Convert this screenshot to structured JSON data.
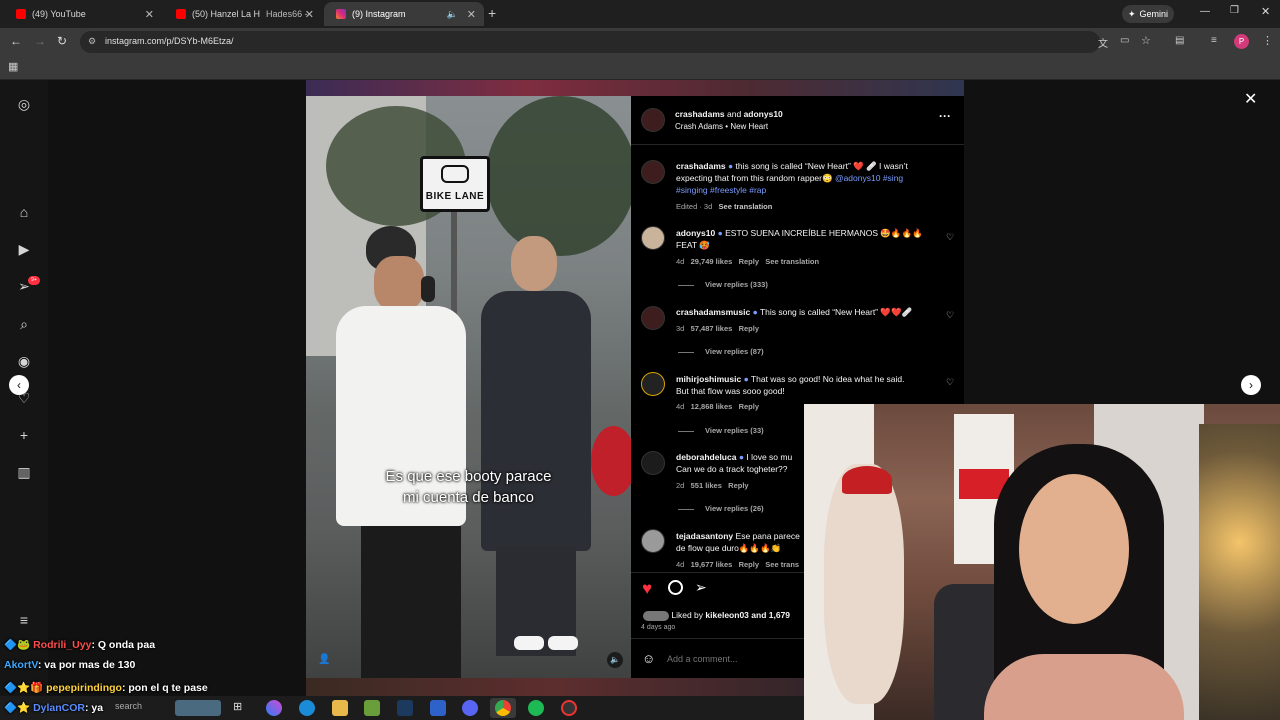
{
  "browser": {
    "tabs": [
      {
        "label": "(49) YouTube",
        "active": false
      },
      {
        "label": "(50) Hanzel La H",
        "label2": "Hades66 -",
        "active": false
      },
      {
        "label": "(9) Instagram",
        "active": true
      }
    ],
    "url": "instagram.com/p/DSYb-M6Etza/",
    "gemini_label": "Gemini",
    "profile_initial": "P"
  },
  "sidebar": {
    "icons": [
      "instagram-icon",
      "home-icon",
      "reels-icon",
      "messages-icon",
      "search-icon",
      "explore-icon",
      "notifications-icon",
      "create-icon",
      "dashboard-icon",
      "more-icon"
    ],
    "notification_badge": "9+"
  },
  "video": {
    "sign_text": "BIKE LANE",
    "subtitle_line1": "Es que ese booty parace",
    "subtitle_line2": "mi cuenta de banco"
  },
  "post": {
    "header": {
      "author": "crashadams",
      "and": "and",
      "collaborator": "adonys10",
      "audio_artist": "Crash Adams",
      "audio_sep": "•",
      "audio_title": "New Heart"
    },
    "caption": {
      "user": "crashadams",
      "text1": "this song is called “New Heart” ❤️ 🩹 I wasn’t",
      "text2": "expecting that from this random rapper😳",
      "mention": "@adonys10",
      "tag_sing": "#sing",
      "tags_line3": "#singing #freestyle #rap",
      "meta": "Edited · 3d",
      "see_translation": "See translation"
    },
    "comments": [
      {
        "user": "adonys10",
        "text1": "ESTO SUENA INCREÍBLE HERMANOS 🤩🔥🔥🔥",
        "text2": "FEAT 🥵",
        "age": "4d",
        "likes": "29,749 likes",
        "reply": "Reply",
        "extra": "See translation",
        "view_replies": "View replies (333)"
      },
      {
        "user": "crashadamsmusic",
        "text1": "This song is called “New Heart” ❤️❤️🩹",
        "text2": "",
        "age": "3d",
        "likes": "57,487 likes",
        "reply": "Reply",
        "extra": "",
        "view_replies": "View replies (87)"
      },
      {
        "user": "mihirjoshimusic",
        "text1": "That was so good! No idea what he said.",
        "text2": "But that flow was sooo good!",
        "age": "4d",
        "likes": "12,868 likes",
        "reply": "Reply",
        "extra": "",
        "view_replies": "View replies (33)"
      },
      {
        "user": "deborahdeluca",
        "text1": "I love so mu",
        "text2": "Can we do a track togheter??",
        "age": "2d",
        "likes": "551 likes",
        "reply": "Reply",
        "extra": "",
        "view_replies": "View replies (26)"
      },
      {
        "user": "tejadasantony",
        "text1": "Ese pana parece",
        "text2": "de flow que duro🔥🔥🔥👏",
        "age": "4d",
        "likes": "19,677 likes",
        "reply": "Reply",
        "extra": "See trans",
        "view_replies": ""
      }
    ],
    "liked_by_prefix": "Liked by",
    "liked_by_user": "kikeleon03",
    "liked_by_suffix": "and 1,679",
    "post_age": "4 days ago",
    "add_comment_placeholder": "Add a comment..."
  },
  "chat": [
    {
      "user": "Rodrili_Uyy",
      "color": "#ff4d4d",
      "msg": ": Q onda paa"
    },
    {
      "user": "AkortV",
      "color": "#3fa9ff",
      "msg": ": va por mas de 130"
    },
    {
      "user": "pepepirindingo",
      "color": "#ffd23f",
      "msg": ": pon el q te pase"
    },
    {
      "user": "DylanCOR",
      "color": "#5b8cff",
      "msg": ": ya"
    }
  ],
  "taskbar": {
    "search_label": "search"
  },
  "colors": {
    "accent_blue": "#7a9cff",
    "like_red": "#ff3040",
    "chrome_dark": "#1f1f1f"
  }
}
